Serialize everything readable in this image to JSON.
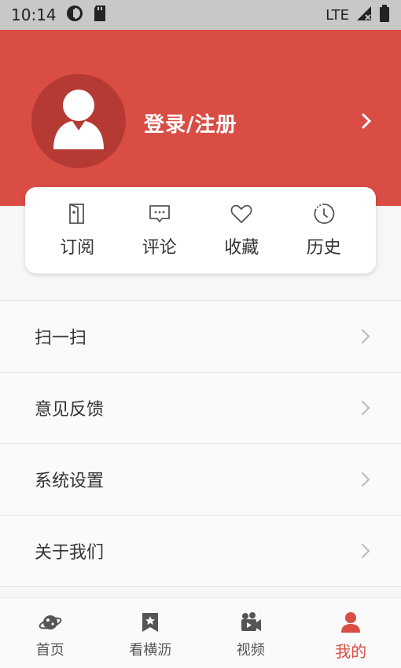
{
  "status_bar": {
    "time": "10:14",
    "network": "LTE"
  },
  "header": {
    "login_label": "登录/注册"
  },
  "quick_actions": [
    {
      "label": "订阅",
      "icon": "subscribe-icon"
    },
    {
      "label": "评论",
      "icon": "comment-icon"
    },
    {
      "label": "收藏",
      "icon": "heart-icon"
    },
    {
      "label": "历史",
      "icon": "history-icon"
    }
  ],
  "menu": [
    {
      "label": "扫一扫"
    },
    {
      "label": "意见反馈"
    },
    {
      "label": "系统设置"
    },
    {
      "label": "关于我们"
    }
  ],
  "tabs": [
    {
      "label": "首页",
      "icon": "planet-icon"
    },
    {
      "label": "看横沥",
      "icon": "bookmark-star-icon"
    },
    {
      "label": "视频",
      "icon": "video-camera-icon"
    },
    {
      "label": "我的",
      "icon": "person-icon",
      "active": true
    }
  ],
  "colors": {
    "brand_red": "#d94d45",
    "avatar_bg": "#b63a34",
    "status_bar_bg": "#c8c8c8"
  }
}
